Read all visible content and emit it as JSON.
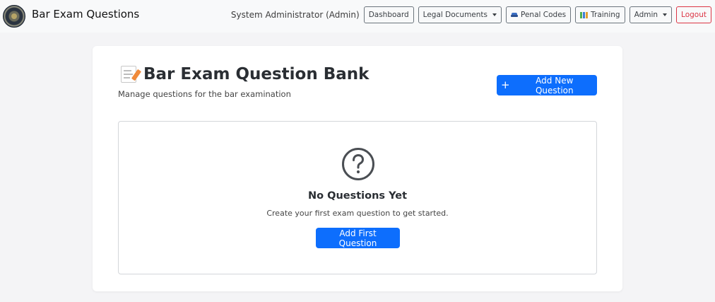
{
  "navbar": {
    "brand_title": "Bar Exam Questions",
    "user_label": "System Administrator (Admin)",
    "dashboard": "Dashboard",
    "legal_documents": "Legal Documents",
    "penal_codes": "Penal Codes",
    "training": "Training",
    "admin": "Admin",
    "logout": "Logout"
  },
  "page": {
    "title": "Bar Exam Question Bank",
    "subtitle": "Manage questions for the bar examination",
    "add_button": "Add New Question",
    "add_icon": "plus-icon"
  },
  "empty_state": {
    "icon": "question-circle-icon",
    "title": "No Questions Yet",
    "text": "Create your first exam question to get started.",
    "button": "Add First Question"
  },
  "colors": {
    "primary": "#0d6efd",
    "danger": "#dc3545",
    "navbar_bg": "#f8f9fa",
    "page_bg": "#f4f4f6"
  }
}
